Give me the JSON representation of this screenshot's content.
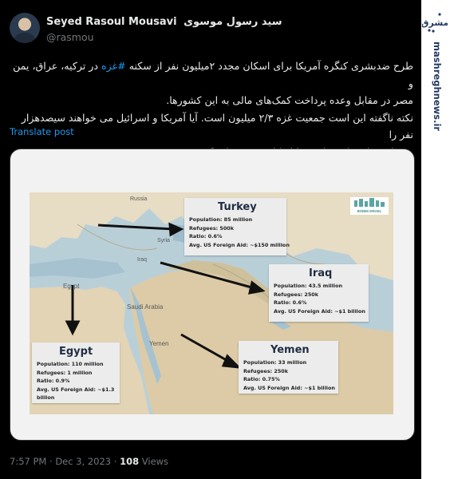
{
  "tweet": {
    "author_name": "Seyed Rasoul Mousavi",
    "author_name_fa": "سید رسول موسوی",
    "handle": "@rasmou",
    "text_lines": [
      "طرح ضدبشری کنگره آمریکا برای اسکان مجدد ۲میلیون نفر از سکنه",
      "در ترکیه، عراق، یمن و",
      "مصر در مقابل وعده پرداخت کمک‌های مالی به این کشورها.",
      "نکته ناگفته این است جمعیت غزه ۲/۳ میلیون است. آیا آمریکا و اسرائیل می خواهند سیصدهزار نفر را",
      "به قتل رسانند تا دومیلیون را اسکان مجدد نمایند؟"
    ],
    "hashtag": "#غزه",
    "translate_label": "Translate post",
    "time": "7:57 PM",
    "date": "Dec 3, 2023",
    "separator": "·",
    "views_count": "108",
    "views_label": "Views"
  },
  "map": {
    "place_labels": [
      "Russia",
      "Syria",
      "Iraq",
      "Egypt",
      "Saudi Arabia",
      "Yemen"
    ],
    "logo_text": "BONIM ISRAEL",
    "countries": [
      {
        "name": "Turkey",
        "population": "Population: 85 million",
        "refugees": "Refugees: 500k",
        "ratio": "Ratio: 0.6%",
        "aid": "Avg. US Foreign Aid: ~$150 million"
      },
      {
        "name": "Iraq",
        "population": "Population: 43.5 million",
        "refugees": "Refugees: 250k",
        "ratio": "Ratio: 0.6%",
        "aid": "Avg. US Foreign Aid: ~$1 billion"
      },
      {
        "name": "Egypt",
        "population": "Population: 110 million",
        "refugees": "Refugees: 1 million",
        "ratio": "Ratio: 0.9%",
        "aid": "Avg. US Foreign Aid: ~$1.3",
        "aid_cont": "billion"
      },
      {
        "name": "Yemen",
        "population": "Population: 33 million",
        "refugees": "Refugees: 250k",
        "ratio": "Ratio: 0.75%",
        "aid": "Avg. US Foreign Aid: ~$1 billion"
      }
    ]
  },
  "sidebar": {
    "brand": "مشرق",
    "url": "mashreghnews.ir"
  },
  "colors": {
    "background": "#000000",
    "text": "#e7e9ea",
    "muted": "#71767b",
    "link": "#1d9bf0",
    "brand": "#243a63"
  }
}
